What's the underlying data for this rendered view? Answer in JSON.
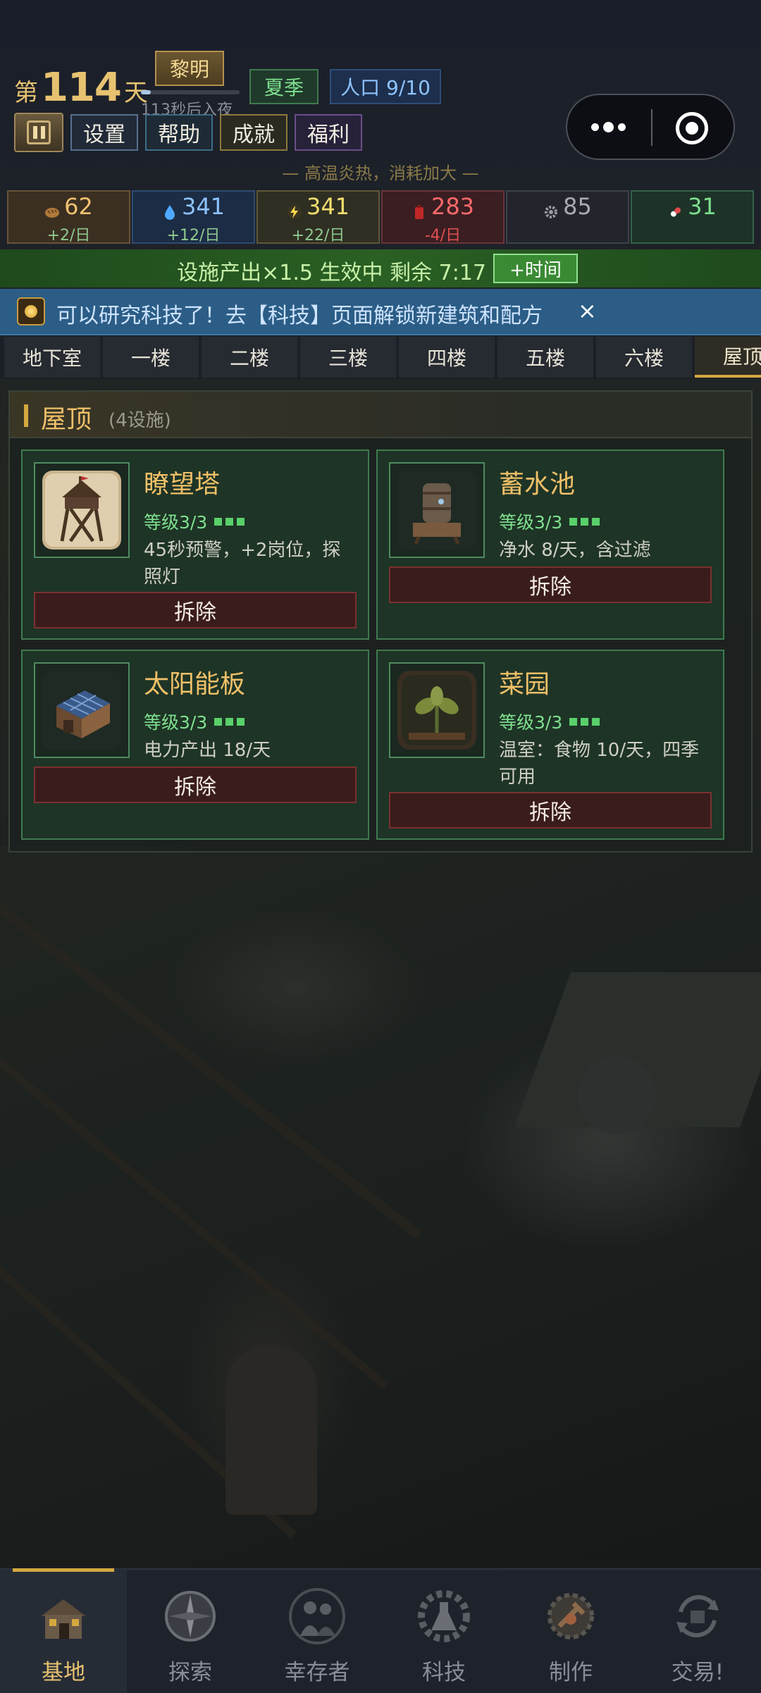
{
  "header": {
    "day_prefix": "第",
    "day_number": "114",
    "day_suffix": "天",
    "phase": "黎明",
    "phase_progress": 0.1,
    "night_note": "113秒后入夜",
    "season": "夏季",
    "population": "人口 9/10",
    "buttons": {
      "settings": "设置",
      "help": "帮助",
      "achievements": "成就",
      "welfare": "福利"
    },
    "heat_note": "— 高温炎热，消耗加大 —"
  },
  "resources": [
    {
      "key": "food",
      "icon": "bread-icon",
      "value": "62",
      "delta": "+2/日"
    },
    {
      "key": "water",
      "icon": "water-drop-icon",
      "value": "341",
      "delta": "+12/日"
    },
    {
      "key": "power",
      "icon": "lightning-icon",
      "value": "341",
      "delta": "+22/日"
    },
    {
      "key": "fuel",
      "icon": "fuel-can-icon",
      "value": "283",
      "delta": "-4/日"
    },
    {
      "key": "parts",
      "icon": "gear-icon",
      "value": "85",
      "delta": ""
    },
    {
      "key": "meds",
      "icon": "pill-icon",
      "value": "31",
      "delta": ""
    }
  ],
  "boost": {
    "text": "设施产出×1.5 生效中  剩余 7:17",
    "button": "+时间"
  },
  "notice": {
    "text": "可以研究科技了！去【科技】页面解锁新建筑和配方",
    "close": "×"
  },
  "tabs": [
    "地下室",
    "一楼",
    "二楼",
    "三楼",
    "四楼",
    "五楼",
    "六楼",
    "屋顶"
  ],
  "active_tab": "屋顶",
  "panel": {
    "title": "屋顶",
    "count": "(4设施)",
    "facilities": [
      {
        "name": "瞭望塔",
        "level": "等级3/3",
        "desc": "45秒预警，+2岗位，探照灯",
        "action": "拆除",
        "icon": "watchtower-icon"
      },
      {
        "name": "蓄水池",
        "level": "等级3/3",
        "desc": "净水 8/天，含过滤",
        "action": "拆除",
        "icon": "water-tank-icon"
      },
      {
        "name": "太阳能板",
        "level": "等级3/3",
        "desc": "电力产出 18/天",
        "action": "拆除",
        "icon": "solar-panel-icon"
      },
      {
        "name": "菜园",
        "level": "等级3/3",
        "desc": "温室：食物 10/天，四季可用",
        "action": "拆除",
        "icon": "garden-icon"
      }
    ]
  },
  "nav": [
    {
      "label": "基地",
      "icon": "base-icon",
      "active": true
    },
    {
      "label": "探索",
      "icon": "compass-icon",
      "active": false
    },
    {
      "label": "幸存者",
      "icon": "survivors-icon",
      "active": false
    },
    {
      "label": "科技",
      "icon": "tech-icon",
      "active": false
    },
    {
      "label": "制作",
      "icon": "craft-icon",
      "active": false
    },
    {
      "label": "交易!",
      "icon": "trade-icon",
      "active": false
    }
  ],
  "colors": {
    "accent": "#d4a840",
    "card_border": "#3e7a4e",
    "boost_green": "#2a6024",
    "notice_blue": "#2b5d86"
  }
}
